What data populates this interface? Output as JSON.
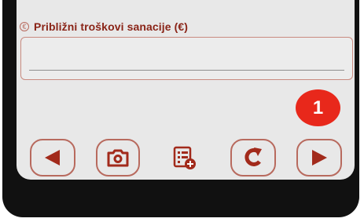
{
  "form": {
    "field_label": "Približni troškovi sanacije (€)",
    "field_value": "",
    "field_icon": "euro-circle-icon"
  },
  "badge": {
    "number": "1",
    "color": "#e8281b"
  },
  "toolbar": {
    "buttons": [
      {
        "name": "back-button",
        "icon": "arrow-left-icon"
      },
      {
        "name": "camera-button",
        "icon": "camera-icon"
      },
      {
        "name": "add-list-button",
        "icon": "list-add-icon"
      },
      {
        "name": "refresh-button",
        "icon": "refresh-icon"
      },
      {
        "name": "forward-button",
        "icon": "arrow-right-icon"
      }
    ]
  },
  "colors": {
    "accent": "#a22a1b",
    "border": "#b86a5e",
    "background": "#e8e8e8"
  }
}
